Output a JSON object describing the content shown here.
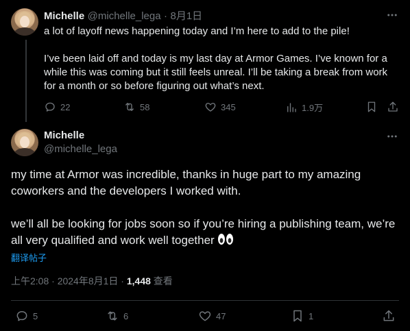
{
  "tweet1": {
    "name": "Michelle",
    "handle": "@michelle_lega",
    "separator": "·",
    "date": "8月1日",
    "text": "a lot of layoff news happening today and I’m here to add to the pile!\n\nI’ve been laid off and today is my last day at Armor Games. I’ve known for a while this was coming but it still feels unreal. I’ll be taking a break from work for a month or so before figuring out what’s next.",
    "replies": "22",
    "reposts": "58",
    "likes": "345",
    "views": "1.9万"
  },
  "tweet2": {
    "name": "Michelle",
    "handle": "@michelle_lega",
    "text": "my time at Armor was incredible, thanks in huge part to my amazing coworkers and the developers I worked with.\n\nwe’ll all be looking for jobs soon so if you’re hiring a publishing team, we’re all very qualified and work well together",
    "translate_label": "翻译帖子",
    "time": "上午2:08 · 2024年8月1日 · ",
    "view_count": "1,448",
    "view_label": " 查看",
    "replies": "5",
    "reposts": "6",
    "likes": "47",
    "bookmarks": "1"
  },
  "colors": {
    "background": "#000000",
    "text": "#e7e9ea",
    "muted": "#71767b",
    "link": "#1d9bf0",
    "divider": "#2f3336"
  }
}
